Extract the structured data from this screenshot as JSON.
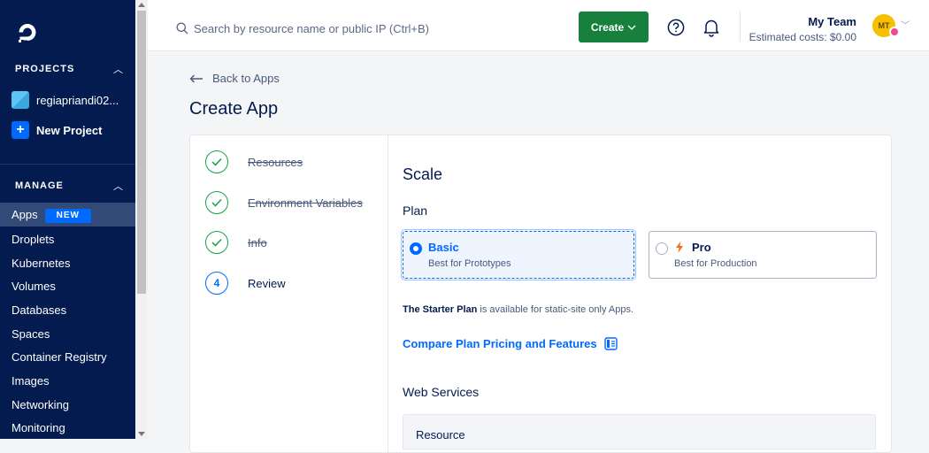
{
  "sidebar": {
    "projects_header": "PROJECTS",
    "project_name": "regiapriandi02...",
    "new_project_label": "New Project",
    "manage_header": "MANAGE",
    "nav": [
      {
        "label": "Apps",
        "badge": "NEW",
        "active": true
      },
      {
        "label": "Droplets"
      },
      {
        "label": "Kubernetes"
      },
      {
        "label": "Volumes"
      },
      {
        "label": "Databases"
      },
      {
        "label": "Spaces"
      },
      {
        "label": "Container Registry"
      },
      {
        "label": "Images"
      },
      {
        "label": "Networking"
      },
      {
        "label": "Monitoring"
      }
    ]
  },
  "topbar": {
    "search_placeholder": "Search by resource name or public IP (Ctrl+B)",
    "create_label": "Create",
    "team_name": "My Team",
    "estimated_costs": "Estimated costs: $0.00",
    "avatar_initials": "MT"
  },
  "page": {
    "back_label": "Back to Apps",
    "title": "Create App"
  },
  "steps": [
    {
      "label": "Resources",
      "state": "done"
    },
    {
      "label": "Environment Variables",
      "state": "done"
    },
    {
      "label": "Info",
      "state": "done"
    },
    {
      "label": "Review",
      "state": "current",
      "number": "4"
    }
  ],
  "scale": {
    "heading": "Scale",
    "plan_label": "Plan",
    "plans": [
      {
        "name": "Basic",
        "desc": "Best for Prototypes",
        "selected": true
      },
      {
        "name": "Pro",
        "desc": "Best for Production",
        "selected": false
      }
    ],
    "note_bold": "The Starter Plan",
    "note_rest": " is available for static-site only Apps.",
    "compare_label": "Compare Plan Pricing and Features",
    "web_services_heading": "Web Services",
    "table_header": "Resource"
  },
  "colors": {
    "sidebar_bg": "#031b4e",
    "accent_blue": "#0069ff",
    "create_green": "#16803c",
    "step_done_green": "#15a34a"
  }
}
